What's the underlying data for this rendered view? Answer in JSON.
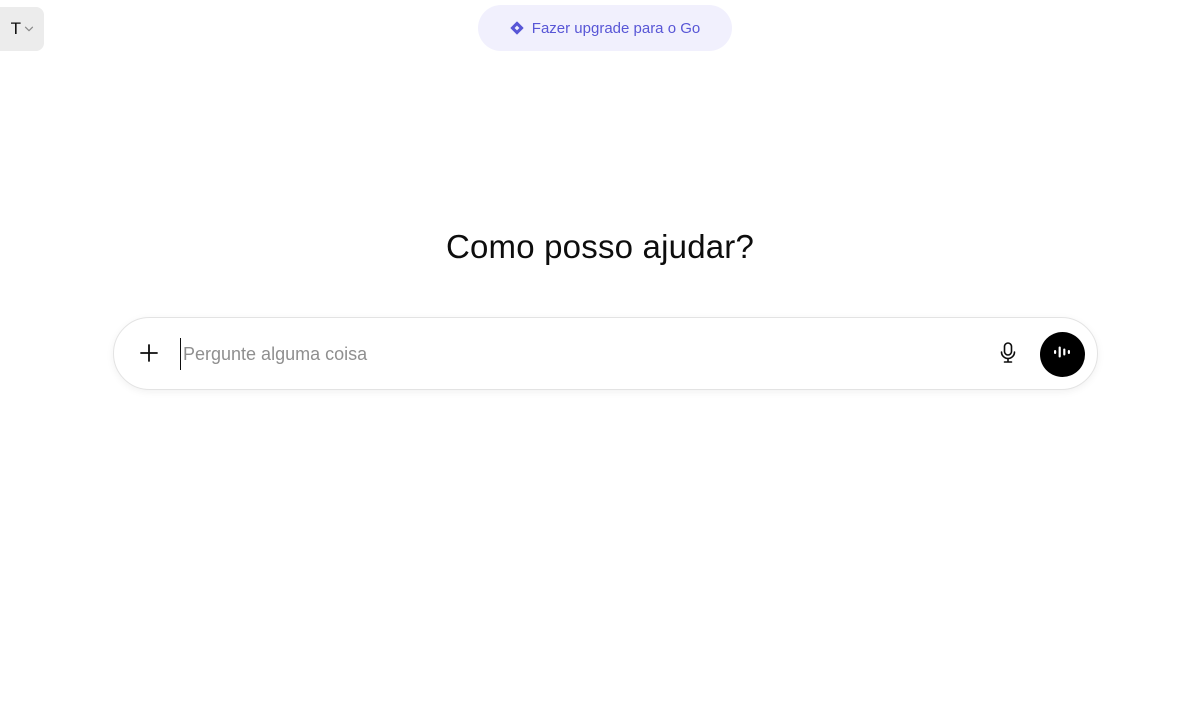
{
  "header": {
    "model_selector_label": "T",
    "chevron_icon": "chevron-down-icon",
    "upgrade": {
      "icon": "diamond-icon",
      "label": "Fazer upgrade para o Go",
      "accent_color": "#5856d6",
      "background_color": "#f1f0fd"
    }
  },
  "main": {
    "heading": "Como posso ajudar?"
  },
  "composer": {
    "add_icon": "plus-icon",
    "placeholder": "Pergunte alguma coisa",
    "value": "",
    "mic_icon": "microphone-icon",
    "voice_icon": "voice-waveform-icon"
  }
}
